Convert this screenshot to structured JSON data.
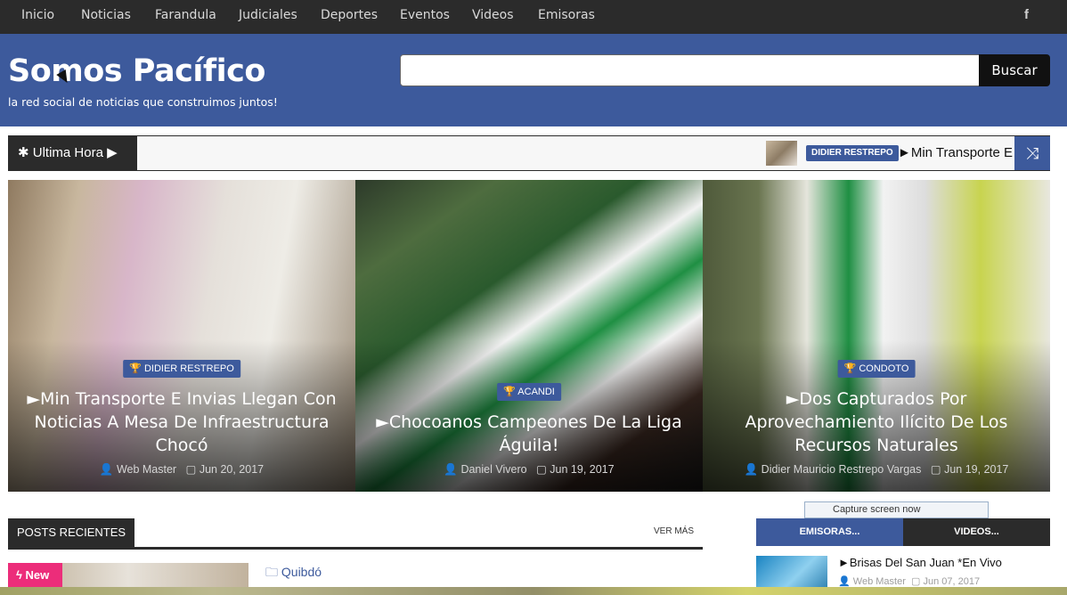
{
  "nav": {
    "items": [
      "Inicio",
      "Noticias",
      "Farandula",
      "Judiciales",
      "Deportes",
      "Eventos",
      "Videos",
      "Emisoras"
    ],
    "social_icon": "facebook-icon",
    "facebook_glyph": "f"
  },
  "header": {
    "brand": "Somos Pacífico",
    "tagline": "la red social de noticias que construimos juntos!",
    "search_placeholder": "",
    "search_button": "Buscar"
  },
  "ticker": {
    "label": "Ultima Hora",
    "label_icon": "pin-icon",
    "tag": "DIDIER RESTREPO",
    "text": "►Min Transporte E",
    "shuffle_icon": "shuffle-icon"
  },
  "featured": [
    {
      "category": "DIDIER RESTREPO",
      "title": "►Min Transporte E Invias Llegan Con Noticias A Mesa De Infraestructura Chocó",
      "author": "Web Master",
      "date": "Jun 20, 2017"
    },
    {
      "category": "ACANDI",
      "title": "►Chocoanos Campeones De La Liga Águila!",
      "author": "Daniel Vivero",
      "date": "Jun 19, 2017"
    },
    {
      "category": "CONDOTO",
      "title": "►Dos Capturados Por Aprovechamiento Ilícito De Los Recursos Naturales",
      "author": "Didier Mauricio Restrepo Vargas",
      "date": "Jun 19, 2017"
    }
  ],
  "recent": {
    "heading": "POSTS RECIENTES",
    "more": "VER MÁS",
    "badge": "New",
    "first_category": "Quibdó"
  },
  "sidebar": {
    "tabs": [
      "EMISORAS...",
      "VIDEOS..."
    ],
    "tooltip": "Capture screen now",
    "item_title": "►Brisas Del San Juan *En Vivo",
    "item_author": "Web Master",
    "item_date": "Jun 07, 2017"
  },
  "colors": {
    "brand_blue": "#3d5a9c",
    "dark": "#2b2b2b",
    "new_badge": "#ec2d7a"
  }
}
